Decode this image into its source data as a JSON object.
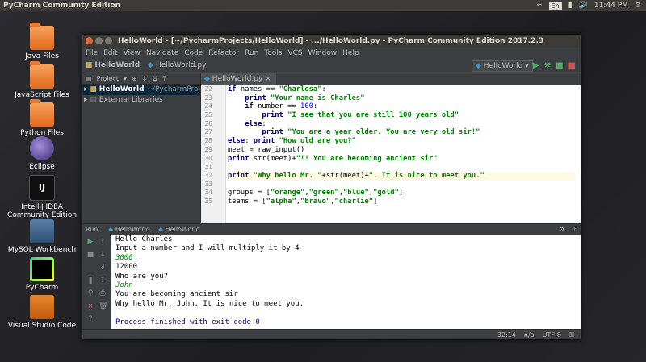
{
  "system_bar": {
    "app_name": "PyCharm Community Edition",
    "keyboard_lang": "En",
    "clock": "11:44 PM"
  },
  "desktop_icons": [
    {
      "label": "Java Files",
      "icon": "folder-icon"
    },
    {
      "label": "JavaScript Files",
      "icon": "folder-icon"
    },
    {
      "label": "Python Files",
      "icon": "folder-icon"
    },
    {
      "label": "Eclipse",
      "icon": "eclipse-icon"
    },
    {
      "label": "IntelliJ IDEA Community Edition",
      "icon": "intellij-icon"
    },
    {
      "label": "MySQL Workbench",
      "icon": "mysql-workbench-icon"
    },
    {
      "label": "PyCharm",
      "icon": "pycharm-icon"
    },
    {
      "label": "Visual Studio Code",
      "icon": "vscode-icon"
    }
  ],
  "window": {
    "title": "HelloWorld - [~/PycharmProjects/HelloWorld] - .../HelloWorld.py - PyCharm Community Edition 2017.2.3"
  },
  "menu": [
    "File",
    "Edit",
    "View",
    "Navigate",
    "Code",
    "Refactor",
    "Run",
    "Tools",
    "VCS",
    "Window",
    "Help"
  ],
  "navbar": {
    "crumb_project": "HelloWorld",
    "crumb_file": "HelloWorld.py",
    "run_config": "HelloWorld"
  },
  "project_panel": {
    "header": "Project",
    "root_name": "HelloWorld",
    "root_path": "~/PycharmProjects/HelloWorld",
    "external_libraries": "External Libraries"
  },
  "editor": {
    "tab_label": "HelloWorld.py",
    "line_numbers": [
      "22",
      "23",
      "24",
      "25",
      "26",
      "27",
      "28",
      "29",
      "30",
      "31",
      "32",
      "33",
      "34",
      "35"
    ],
    "current_line_index": 10
  },
  "run_panel": {
    "label": "Run:",
    "tab1": "HelloWorld",
    "tab2": "HelloWorld",
    "console_lines": [
      {
        "text": "Hello Charles",
        "type": "out"
      },
      {
        "text": "Input a number and I will multiply it by 4",
        "type": "out"
      },
      {
        "text": "3000",
        "type": "input"
      },
      {
        "text": "12000",
        "type": "out"
      },
      {
        "text": "Who are you?",
        "type": "out"
      },
      {
        "text": "John",
        "type": "input"
      },
      {
        "text": "You are becoming ancient sir",
        "type": "out"
      },
      {
        "text": "Why hello Mr. John. It is nice to meet you.",
        "type": "out"
      },
      {
        "text": "",
        "type": "out"
      },
      {
        "text": "Process finished with exit code 0",
        "type": "exit"
      }
    ]
  },
  "statusbar": {
    "position": "32:14",
    "line_sep": "n/a",
    "encoding": "UTF-8"
  }
}
